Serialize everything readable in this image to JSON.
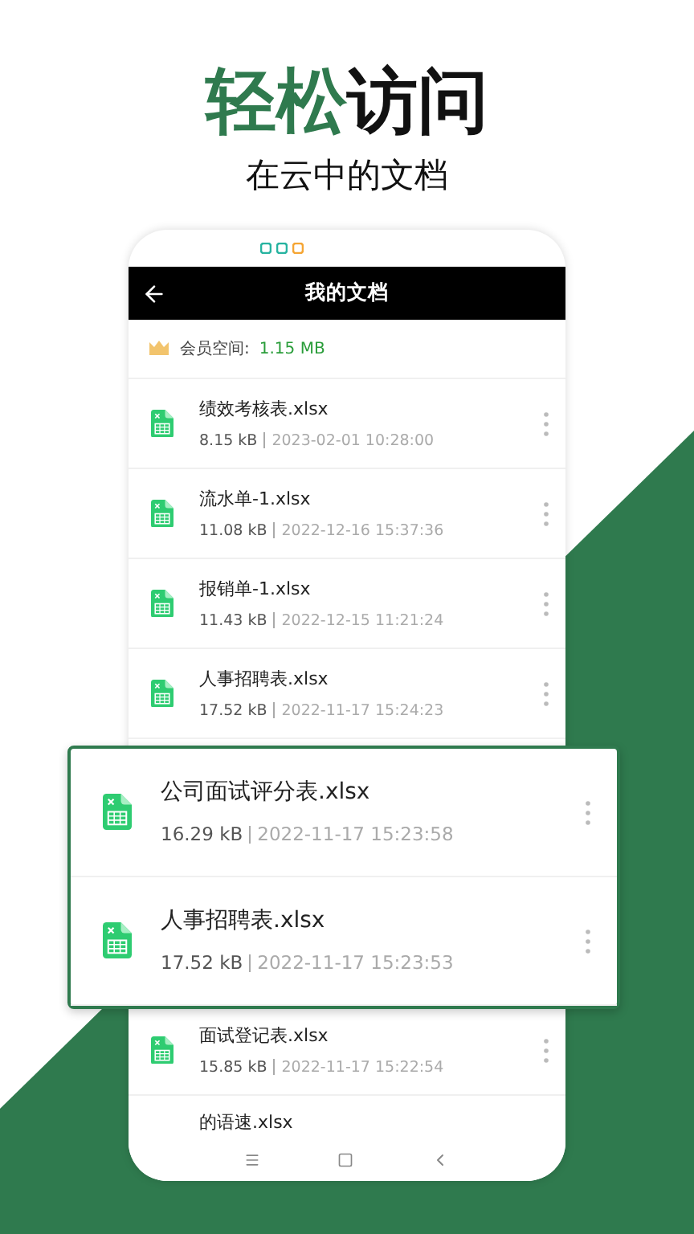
{
  "headline": [
    {
      "text": "轻松",
      "color": "#2f7a4e"
    },
    {
      "text": "访问",
      "color": "#111111"
    }
  ],
  "subtitle": "在云中的文档",
  "phone": {
    "title": "我的文档",
    "storage_label": "会员空间:",
    "storage_value": "1.15 MB",
    "files": [
      {
        "name": "绩效考核表.xlsx",
        "size": "8.15 kB",
        "date": "2023-02-01 10:28:00"
      },
      {
        "name": "流水单-1.xlsx",
        "size": "11.08 kB",
        "date": "2022-12-16 15:37:36"
      },
      {
        "name": "报销单-1.xlsx",
        "size": "11.43 kB",
        "date": "2022-12-15 11:21:24"
      },
      {
        "name": "人事招聘表.xlsx",
        "size": "17.52 kB",
        "date": "2022-11-17 15:24:23"
      }
    ],
    "files_below": [
      {
        "name": "面试登记表.xlsx",
        "size": "15.85 kB",
        "date": "2022-11-17 15:22:54"
      }
    ],
    "partial_file": {
      "name": "的语速.xlsx"
    }
  },
  "popup": {
    "files": [
      {
        "name": "公司面试评分表.xlsx",
        "size": "16.29 kB",
        "date": "2022-11-17 15:23:58"
      },
      {
        "name": "人事招聘表.xlsx",
        "size": "17.52 kB",
        "date": "2022-11-17 15:23:53"
      }
    ]
  }
}
